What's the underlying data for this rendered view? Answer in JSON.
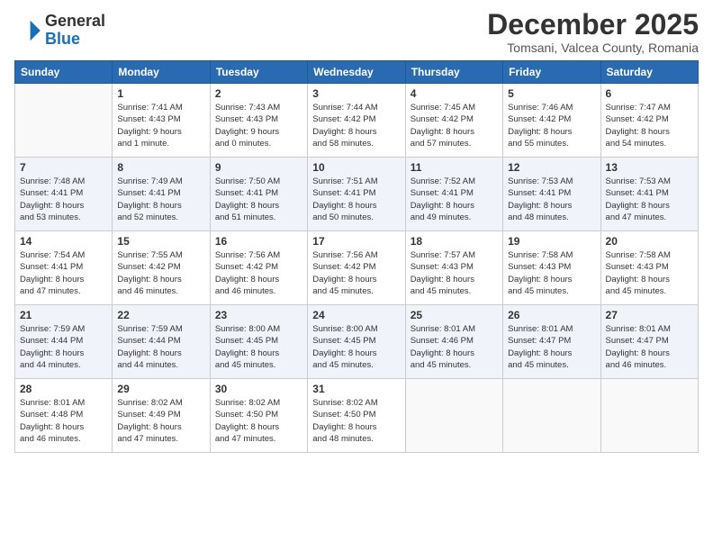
{
  "header": {
    "logo_line1": "General",
    "logo_line2": "Blue",
    "month": "December 2025",
    "location": "Tomsani, Valcea County, Romania"
  },
  "weekdays": [
    "Sunday",
    "Monday",
    "Tuesday",
    "Wednesday",
    "Thursday",
    "Friday",
    "Saturday"
  ],
  "weeks": [
    [
      {
        "day": "",
        "detail": ""
      },
      {
        "day": "1",
        "detail": "Sunrise: 7:41 AM\nSunset: 4:43 PM\nDaylight: 9 hours\nand 1 minute."
      },
      {
        "day": "2",
        "detail": "Sunrise: 7:43 AM\nSunset: 4:43 PM\nDaylight: 9 hours\nand 0 minutes."
      },
      {
        "day": "3",
        "detail": "Sunrise: 7:44 AM\nSunset: 4:42 PM\nDaylight: 8 hours\nand 58 minutes."
      },
      {
        "day": "4",
        "detail": "Sunrise: 7:45 AM\nSunset: 4:42 PM\nDaylight: 8 hours\nand 57 minutes."
      },
      {
        "day": "5",
        "detail": "Sunrise: 7:46 AM\nSunset: 4:42 PM\nDaylight: 8 hours\nand 55 minutes."
      },
      {
        "day": "6",
        "detail": "Sunrise: 7:47 AM\nSunset: 4:42 PM\nDaylight: 8 hours\nand 54 minutes."
      }
    ],
    [
      {
        "day": "7",
        "detail": "Sunrise: 7:48 AM\nSunset: 4:41 PM\nDaylight: 8 hours\nand 53 minutes."
      },
      {
        "day": "8",
        "detail": "Sunrise: 7:49 AM\nSunset: 4:41 PM\nDaylight: 8 hours\nand 52 minutes."
      },
      {
        "day": "9",
        "detail": "Sunrise: 7:50 AM\nSunset: 4:41 PM\nDaylight: 8 hours\nand 51 minutes."
      },
      {
        "day": "10",
        "detail": "Sunrise: 7:51 AM\nSunset: 4:41 PM\nDaylight: 8 hours\nand 50 minutes."
      },
      {
        "day": "11",
        "detail": "Sunrise: 7:52 AM\nSunset: 4:41 PM\nDaylight: 8 hours\nand 49 minutes."
      },
      {
        "day": "12",
        "detail": "Sunrise: 7:53 AM\nSunset: 4:41 PM\nDaylight: 8 hours\nand 48 minutes."
      },
      {
        "day": "13",
        "detail": "Sunrise: 7:53 AM\nSunset: 4:41 PM\nDaylight: 8 hours\nand 47 minutes."
      }
    ],
    [
      {
        "day": "14",
        "detail": "Sunrise: 7:54 AM\nSunset: 4:41 PM\nDaylight: 8 hours\nand 47 minutes."
      },
      {
        "day": "15",
        "detail": "Sunrise: 7:55 AM\nSunset: 4:42 PM\nDaylight: 8 hours\nand 46 minutes."
      },
      {
        "day": "16",
        "detail": "Sunrise: 7:56 AM\nSunset: 4:42 PM\nDaylight: 8 hours\nand 46 minutes."
      },
      {
        "day": "17",
        "detail": "Sunrise: 7:56 AM\nSunset: 4:42 PM\nDaylight: 8 hours\nand 45 minutes."
      },
      {
        "day": "18",
        "detail": "Sunrise: 7:57 AM\nSunset: 4:43 PM\nDaylight: 8 hours\nand 45 minutes."
      },
      {
        "day": "19",
        "detail": "Sunrise: 7:58 AM\nSunset: 4:43 PM\nDaylight: 8 hours\nand 45 minutes."
      },
      {
        "day": "20",
        "detail": "Sunrise: 7:58 AM\nSunset: 4:43 PM\nDaylight: 8 hours\nand 45 minutes."
      }
    ],
    [
      {
        "day": "21",
        "detail": "Sunrise: 7:59 AM\nSunset: 4:44 PM\nDaylight: 8 hours\nand 44 minutes."
      },
      {
        "day": "22",
        "detail": "Sunrise: 7:59 AM\nSunset: 4:44 PM\nDaylight: 8 hours\nand 44 minutes."
      },
      {
        "day": "23",
        "detail": "Sunrise: 8:00 AM\nSunset: 4:45 PM\nDaylight: 8 hours\nand 45 minutes."
      },
      {
        "day": "24",
        "detail": "Sunrise: 8:00 AM\nSunset: 4:45 PM\nDaylight: 8 hours\nand 45 minutes."
      },
      {
        "day": "25",
        "detail": "Sunrise: 8:01 AM\nSunset: 4:46 PM\nDaylight: 8 hours\nand 45 minutes."
      },
      {
        "day": "26",
        "detail": "Sunrise: 8:01 AM\nSunset: 4:47 PM\nDaylight: 8 hours\nand 45 minutes."
      },
      {
        "day": "27",
        "detail": "Sunrise: 8:01 AM\nSunset: 4:47 PM\nDaylight: 8 hours\nand 46 minutes."
      }
    ],
    [
      {
        "day": "28",
        "detail": "Sunrise: 8:01 AM\nSunset: 4:48 PM\nDaylight: 8 hours\nand 46 minutes."
      },
      {
        "day": "29",
        "detail": "Sunrise: 8:02 AM\nSunset: 4:49 PM\nDaylight: 8 hours\nand 47 minutes."
      },
      {
        "day": "30",
        "detail": "Sunrise: 8:02 AM\nSunset: 4:50 PM\nDaylight: 8 hours\nand 47 minutes."
      },
      {
        "day": "31",
        "detail": "Sunrise: 8:02 AM\nSunset: 4:50 PM\nDaylight: 8 hours\nand 48 minutes."
      },
      {
        "day": "",
        "detail": ""
      },
      {
        "day": "",
        "detail": ""
      },
      {
        "day": "",
        "detail": ""
      }
    ]
  ]
}
